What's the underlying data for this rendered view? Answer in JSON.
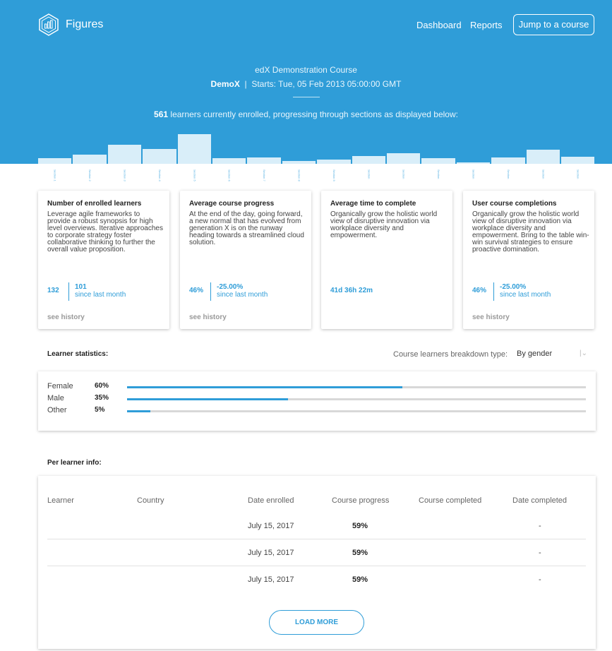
{
  "header": {
    "logo_text": "Figures",
    "nav": [
      {
        "label": "Dashboard"
      },
      {
        "label": "Reports"
      }
    ],
    "jump_button": "Jump to a course"
  },
  "course": {
    "name": "edX Demonstration Course",
    "code": "DemoX",
    "separator": "|",
    "starts": "Starts: Tue, 05 Feb 2013 05:00:00 GMT",
    "enrolled_count": "561",
    "enrolled_text": "learners currently enrolled, progressing through sections as displayed below:"
  },
  "histogram": {
    "bar_color": "#d9eef9",
    "bar_levels": [
      8,
      13,
      26,
      21,
      41,
      8,
      9,
      4,
      6,
      11,
      15,
      8,
      2,
      9,
      20,
      10
    ],
    "section_labels": [
      "Section 1",
      "Section 2",
      "Section 3",
      "Section 4",
      "Section 5",
      "Section 6",
      "Section 7",
      "Section 8",
      "Section 9",
      "Section 10",
      "Section 11",
      "Section 12",
      "Section 13",
      "Section 14",
      "Section 15",
      "Section 16"
    ]
  },
  "cards": [
    {
      "title": "Number of enrolled learners",
      "text": "Leverage agile frameworks to provide a robust synopsis for high level overviews. Iterative approaches to corporate strategy foster collaborative thinking to further the overall value proposition.",
      "value": "132",
      "change": "101",
      "change_label": "since last month",
      "history": "see history"
    },
    {
      "title": "Average course progress",
      "text": "At the end of the day, going forward, a new normal that has evolved from generation X is on the runway heading towards a streamlined cloud solution.",
      "value": "46%",
      "change": "-25.00%",
      "change_label": "since last month",
      "history": "see history"
    },
    {
      "title": "Average time to complete",
      "text": "Organically grow the holistic world view of disruptive innovation via workplace diversity and empowerment.",
      "value": "41d 36h 22m"
    },
    {
      "title": "User course completions",
      "text": "Organically grow the holistic world view of disruptive innovation via workplace diversity and empowerment. Bring to the table win-win survival strategies to ensure proactive domination.",
      "value": "46%",
      "change": "-25.00%",
      "change_label": "since last month",
      "history": "see history"
    }
  ],
  "learner_stats": {
    "label": "Learner statistics:",
    "breakdown_label": "Course learners breakdown type:",
    "breakdown_value": "By gender",
    "rows": [
      {
        "label": "Female",
        "pct": "60%",
        "fraction": 0.6
      },
      {
        "label": "Male",
        "pct": "35%",
        "fraction": 0.35
      },
      {
        "label": "Other",
        "pct": "5%",
        "fraction": 0.05
      }
    ]
  },
  "per_learner": {
    "label": "Per learner info:",
    "headers": [
      "Learner",
      "Country",
      "Date enrolled",
      "Course progress",
      "Course completed",
      "Date completed"
    ],
    "rows": [
      {
        "learner": "",
        "country": "",
        "date_enrolled": "July 15, 2017",
        "progress": "59%",
        "completed": "",
        "date_completed": "-"
      },
      {
        "learner": "",
        "country": "",
        "date_enrolled": "July 15, 2017",
        "progress": "59%",
        "completed": "",
        "date_completed": "-"
      },
      {
        "learner": "",
        "country": "",
        "date_enrolled": "July 15, 2017",
        "progress": "59%",
        "completed": "",
        "date_completed": "-"
      }
    ],
    "load_more": "LOAD MORE"
  },
  "colors": {
    "accent": "#2f9dd8",
    "header_bg": "#2f9dd8"
  }
}
